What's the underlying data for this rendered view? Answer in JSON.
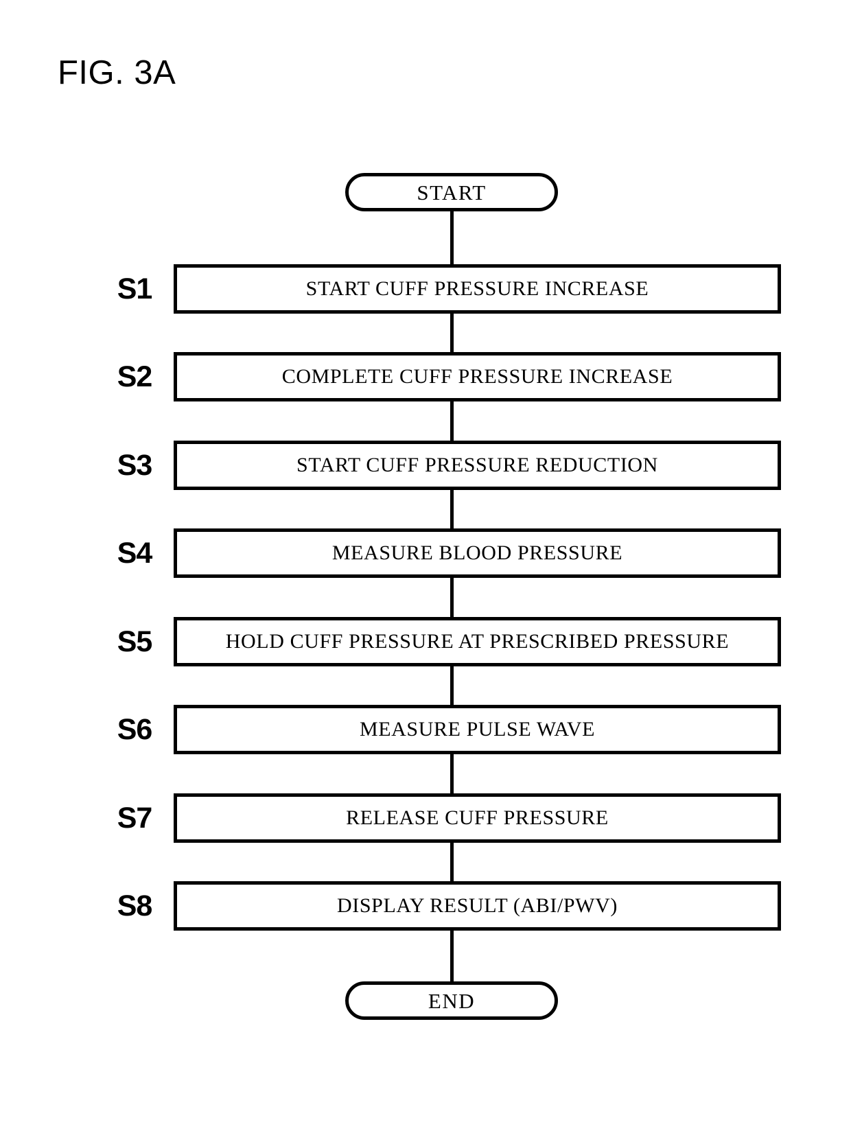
{
  "figure": {
    "title": "FIG. 3A",
    "type": "flowchart",
    "orientation": "vertical"
  },
  "flowchart": {
    "start_terminator": {
      "label": "START",
      "shape": "stadium"
    },
    "end_terminator": {
      "label": "END",
      "shape": "stadium"
    },
    "steps": [
      {
        "id": "S1",
        "label": "START CUFF PRESSURE INCREASE"
      },
      {
        "id": "S2",
        "label": "COMPLETE CUFF PRESSURE INCREASE"
      },
      {
        "id": "S3",
        "label": "START CUFF PRESSURE REDUCTION"
      },
      {
        "id": "S4",
        "label": "MEASURE BLOOD PRESSURE"
      },
      {
        "id": "S5",
        "label": "HOLD CUFF PRESSURE AT PRESCRIBED PRESSURE"
      },
      {
        "id": "S6",
        "label": "MEASURE PULSE WAVE"
      },
      {
        "id": "S7",
        "label": "RELEASE CUFF PRESSURE"
      },
      {
        "id": "S8",
        "label": "DISPLAY RESULT (ABI/PWV)"
      }
    ],
    "colors": {
      "stroke": "#000000",
      "fill": "#ffffff",
      "text": "#000000"
    }
  }
}
